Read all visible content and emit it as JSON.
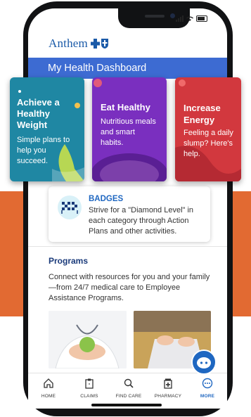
{
  "brand": {
    "name": "Anthem",
    "accent": "#1a5aa8",
    "header_color": "#3d6bd2",
    "page_accent": "#e26a32"
  },
  "header": {
    "title": "My Health Dashboard"
  },
  "cards": [
    {
      "title": "Achieve a Healthy Weight",
      "subtitle": "Simple plans to help you succeed.",
      "color": "#1f87a3"
    },
    {
      "title": "Eat Healthy",
      "subtitle": "Nutritious meals and smart habits.",
      "color": "#7a2fbf"
    },
    {
      "title": "Increase Energy",
      "subtitle": "Feeling a daily slump? Here's help.",
      "color": "#d2383e"
    }
  ],
  "badges": {
    "title": "BADGES",
    "description": "Strive for a \"Diamond Level\" in each category through Action Plans and other activities.",
    "icon": "checkered-flags-icon"
  },
  "programs": {
    "title": "Programs",
    "description": "Connect with resources for you and your family—from 24/7 medical care to Employee Assistance Programs."
  },
  "tabs": [
    {
      "label": "HOME",
      "icon": "home-icon"
    },
    {
      "label": "CLAIMS",
      "icon": "clipboard-icon"
    },
    {
      "label": "FIND CARE",
      "icon": "search-icon"
    },
    {
      "label": "PHARMACY",
      "icon": "pharmacy-icon"
    },
    {
      "label": "MORE",
      "icon": "more-icon",
      "active": true
    }
  ]
}
